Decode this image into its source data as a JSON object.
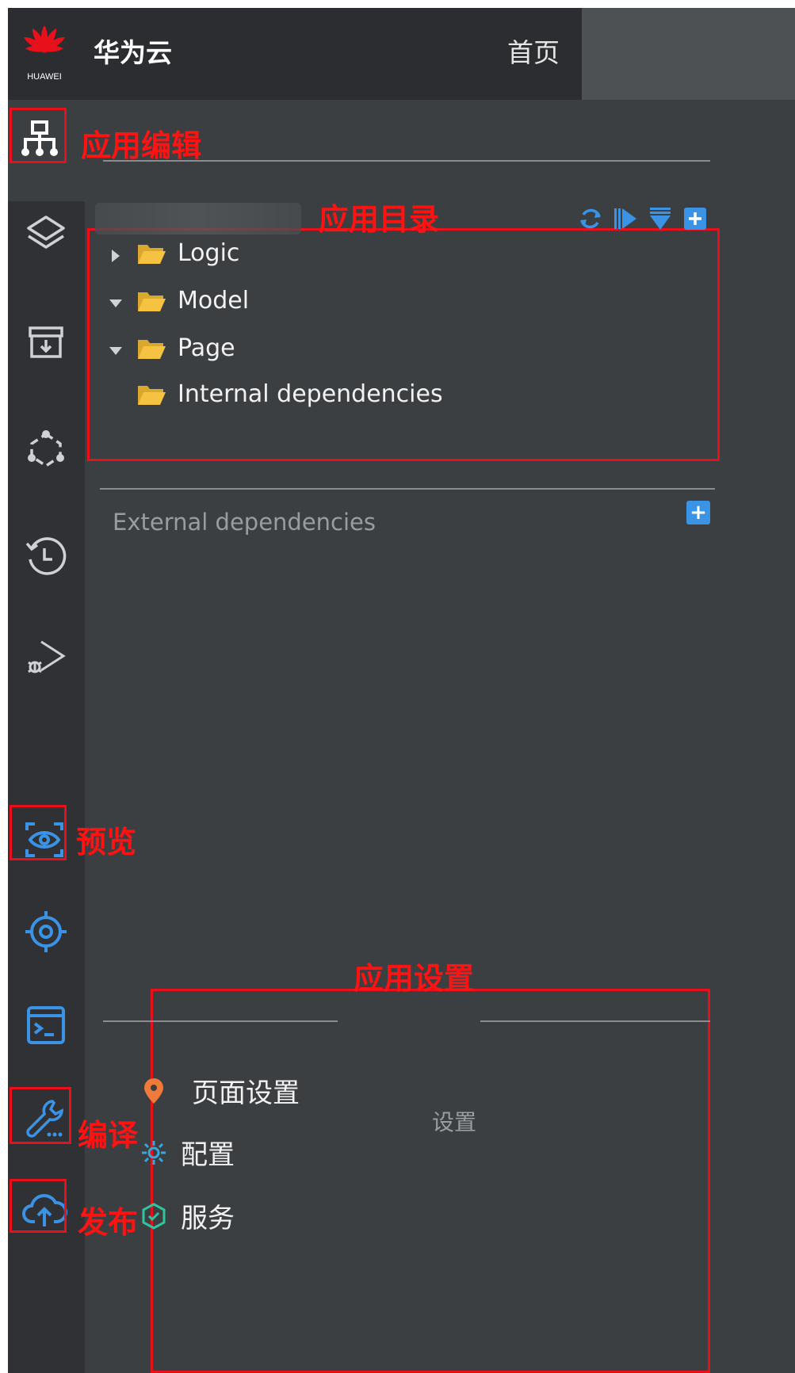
{
  "header": {
    "brand_text": "HUAWEI",
    "app_name": "华为云",
    "home": "首页"
  },
  "annotations": {
    "app_edit": "应用编辑",
    "app_directory": "应用目录",
    "preview": "预览",
    "app_settings": "应用设置",
    "compile": "编译",
    "publish": "发布"
  },
  "tree": {
    "items": [
      {
        "label": "Logic",
        "expanded": false
      },
      {
        "label": "Model",
        "expanded": true
      },
      {
        "label": "Page",
        "expanded": true
      },
      {
        "label": "Internal dependencies",
        "expanded": null
      }
    ]
  },
  "external_dependencies": {
    "label": "External dependencies"
  },
  "settings": {
    "section_label": "设置",
    "items": [
      {
        "label": "页面设置",
        "icon": "location-pin-icon"
      },
      {
        "label": "配置",
        "icon": "gear-icon"
      },
      {
        "label": "服务",
        "icon": "hexagon-service-icon"
      }
    ]
  },
  "colors": {
    "annotation_red": "#e8111b",
    "accent_blue": "#3b93e6",
    "folder_yellow": "#f5c242",
    "panel_bg": "#3c3f42",
    "rail_bg": "#2f3134"
  }
}
